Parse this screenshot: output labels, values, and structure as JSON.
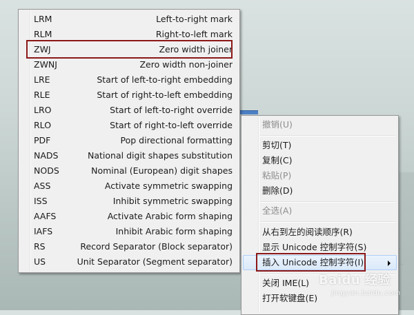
{
  "submenu": {
    "items": [
      {
        "code": "LRM",
        "desc": "Left-to-right mark"
      },
      {
        "code": "RLM",
        "desc": "Right-to-left mark"
      },
      {
        "code": "ZWJ",
        "desc": "Zero width joiner"
      },
      {
        "code": "ZWNJ",
        "desc": "Zero width non-joiner"
      },
      {
        "code": "LRE",
        "desc": "Start of left-to-right embedding"
      },
      {
        "code": "RLE",
        "desc": "Start of right-to-left embedding"
      },
      {
        "code": "LRO",
        "desc": "Start of left-to-right override"
      },
      {
        "code": "RLO",
        "desc": "Start of right-to-left override"
      },
      {
        "code": "PDF",
        "desc": "Pop directional formatting"
      },
      {
        "code": "NADS",
        "desc": "National digit shapes substitution"
      },
      {
        "code": "NODS",
        "desc": "Nominal (European) digit shapes"
      },
      {
        "code": "ASS",
        "desc": "Activate symmetric swapping"
      },
      {
        "code": "ISS",
        "desc": "Inhibit symmetric swapping"
      },
      {
        "code": "AAFS",
        "desc": "Activate Arabic form shaping"
      },
      {
        "code": "IAFS",
        "desc": "Inhibit Arabic form shaping"
      },
      {
        "code": "RS",
        "desc": "Record Separator (Block separator)"
      },
      {
        "code": "US",
        "desc": "Unit Separator (Segment separator)"
      }
    ]
  },
  "context_menu": {
    "items": [
      {
        "label": "撤销(U)",
        "disabled": true
      },
      {
        "label": "剪切(T)",
        "disabled": false
      },
      {
        "label": "复制(C)",
        "disabled": false
      },
      {
        "label": "粘贴(P)",
        "disabled": true
      },
      {
        "label": "删除(D)",
        "disabled": false
      },
      {
        "label": "全选(A)",
        "disabled": true
      },
      {
        "label": "从右到左的阅读顺序(R)",
        "disabled": false
      },
      {
        "label": "显示 Unicode 控制字符(S)",
        "disabled": false
      },
      {
        "label": "插入 Unicode 控制字符(I)",
        "disabled": false,
        "submenu": true
      },
      {
        "label": "关闭 IME(L)",
        "disabled": false
      },
      {
        "label": "打开软键盘(E)",
        "disabled": false
      }
    ]
  },
  "watermark": {
    "brand": "Baidu 经验",
    "url": "jingyan.baidu.com"
  },
  "colors": {
    "highlight_border": "#8b1717",
    "menu_background": "#f0f0f0",
    "hover_background": "#dbe9f9",
    "disabled_text": "#8d8d8d"
  }
}
